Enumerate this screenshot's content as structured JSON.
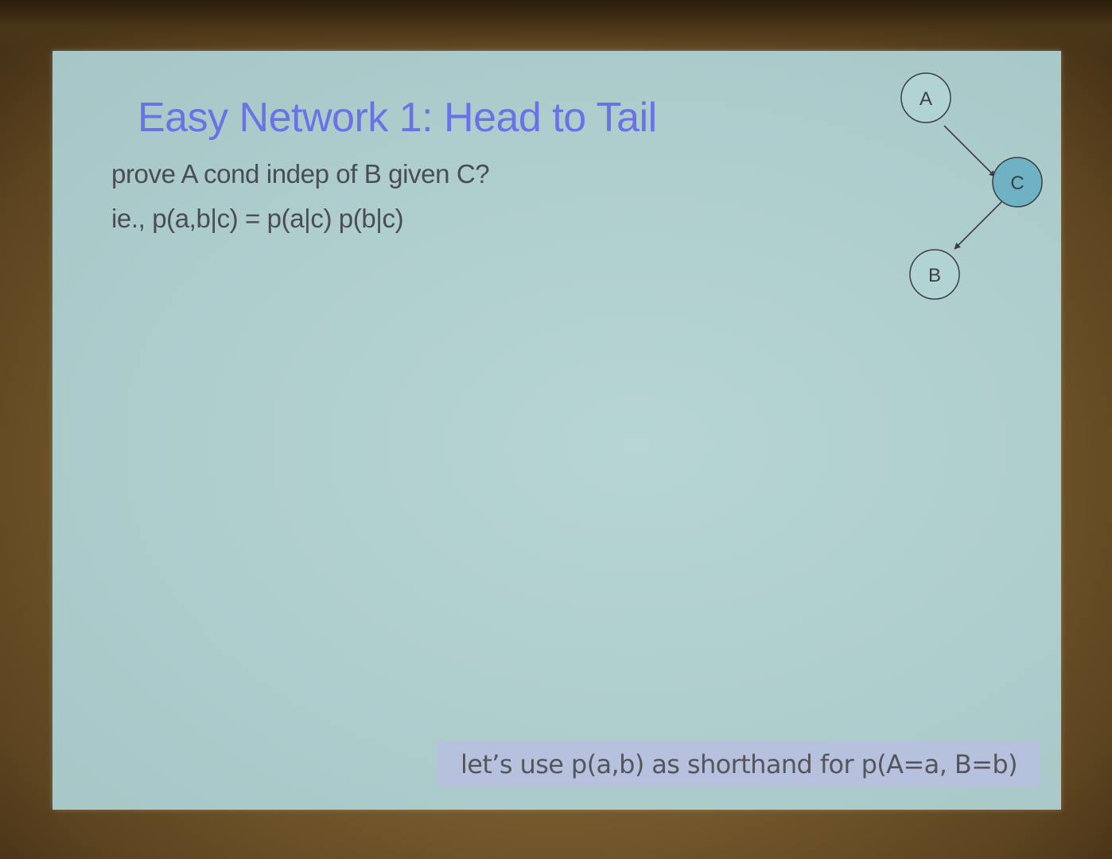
{
  "slide": {
    "title": "Easy Network 1: Head to Tail",
    "lines": [
      "prove A cond indep of B given C?",
      "ie., p(a,b|c) = p(a|c) p(b|c)"
    ],
    "footnote": "let’s use p(a,b) as shorthand for p(A=a, B=b)"
  },
  "diagram": {
    "nodes": [
      {
        "id": "A",
        "label": "A",
        "observed": false
      },
      {
        "id": "C",
        "label": "C",
        "observed": true
      },
      {
        "id": "B",
        "label": "B",
        "observed": false
      }
    ],
    "edges": [
      {
        "from": "A",
        "to": "C"
      },
      {
        "from": "C",
        "to": "B"
      }
    ]
  },
  "colors": {
    "title": "#6b72e6",
    "body_text": "#4a4e52",
    "slide_background": "#aecdcd",
    "observed_node_fill": "#6fb2c4",
    "footnote_highlight": "#b6c2dd"
  }
}
